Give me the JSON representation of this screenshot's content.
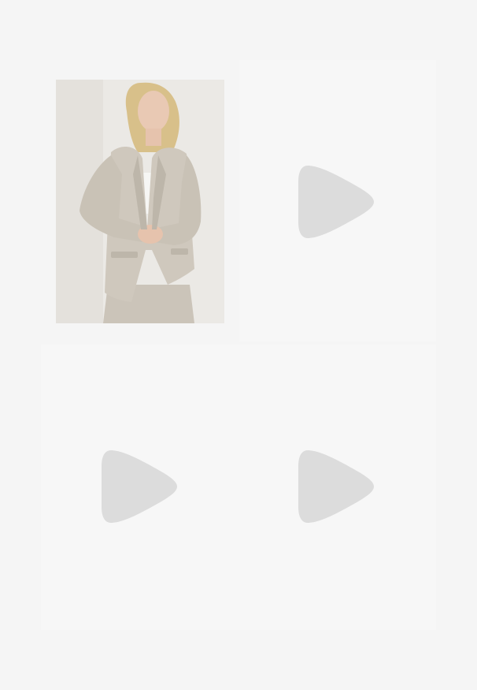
{
  "gallery": {
    "tiles": [
      {
        "kind": "image",
        "icon": "product-photo",
        "alt": ""
      },
      {
        "kind": "video",
        "icon": "play-icon"
      },
      {
        "kind": "video",
        "icon": "play-icon"
      },
      {
        "kind": "video",
        "icon": "play-icon"
      }
    ]
  },
  "colors": {
    "background": "#f5f5f5",
    "tile": "#f7f7f7",
    "placeholder_icon": "#dcdcdc",
    "blazer": "#cfc8bd"
  }
}
